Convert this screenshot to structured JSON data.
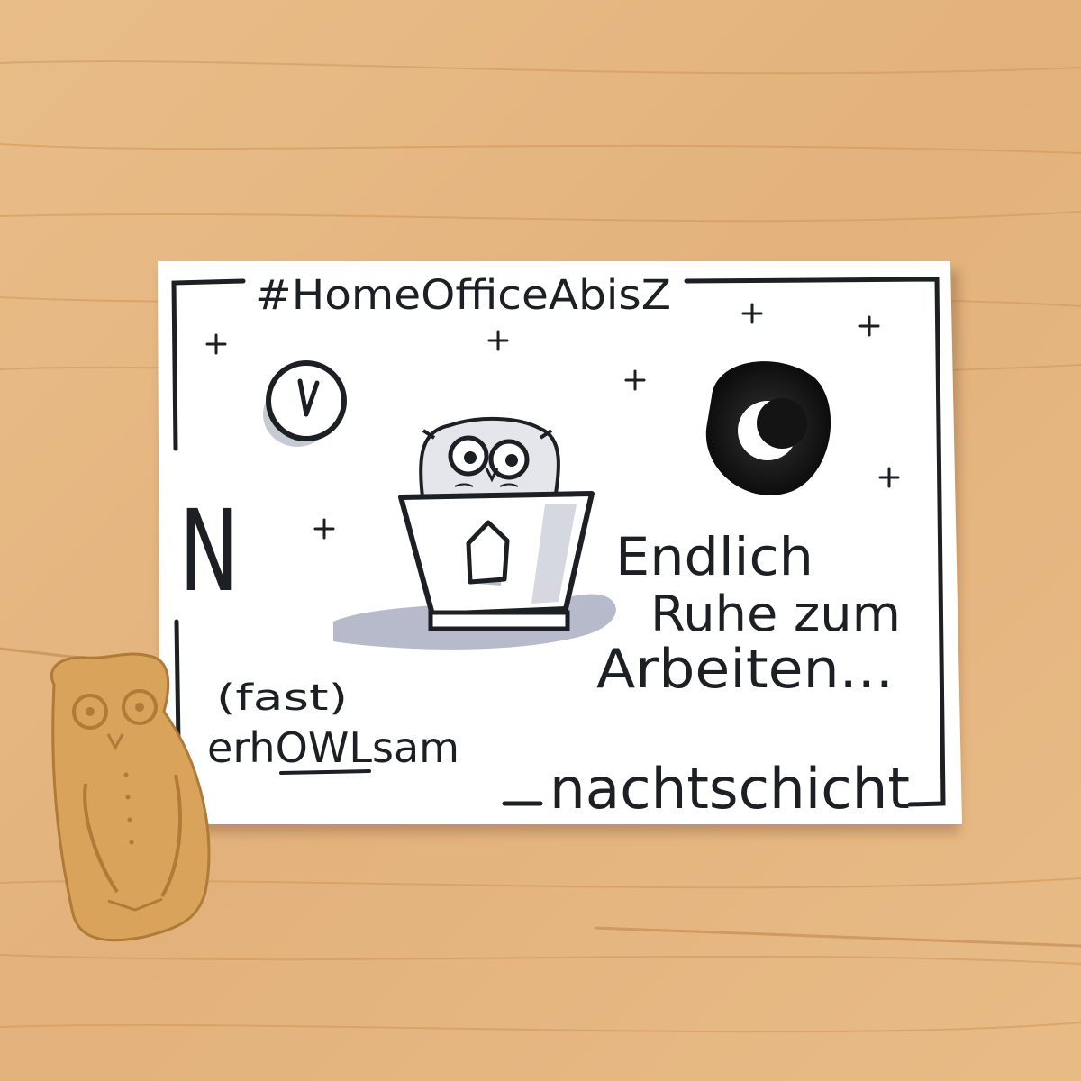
{
  "card": {
    "hashtag": "#HomeOfficeAbisZ",
    "letter": "N",
    "message_line1": "Endlich",
    "message_line2": "Ruhe zum",
    "message_line3": "Arbeiten...",
    "subtitle_line1": "(fast)",
    "subtitle_line2": "erhOWLsam",
    "footer_word": "nachtschicht"
  },
  "colors": {
    "wood": "#e6b883",
    "card": "#ffffff",
    "ink": "#1c1f24",
    "shadow": "#b7bccb",
    "biscuit": "#d9a35c"
  },
  "icons": [
    "clock-icon",
    "moon-icon",
    "owl-drawing",
    "laptop-icon",
    "home-icon",
    "sparkle-icon",
    "owl-biscuit"
  ]
}
